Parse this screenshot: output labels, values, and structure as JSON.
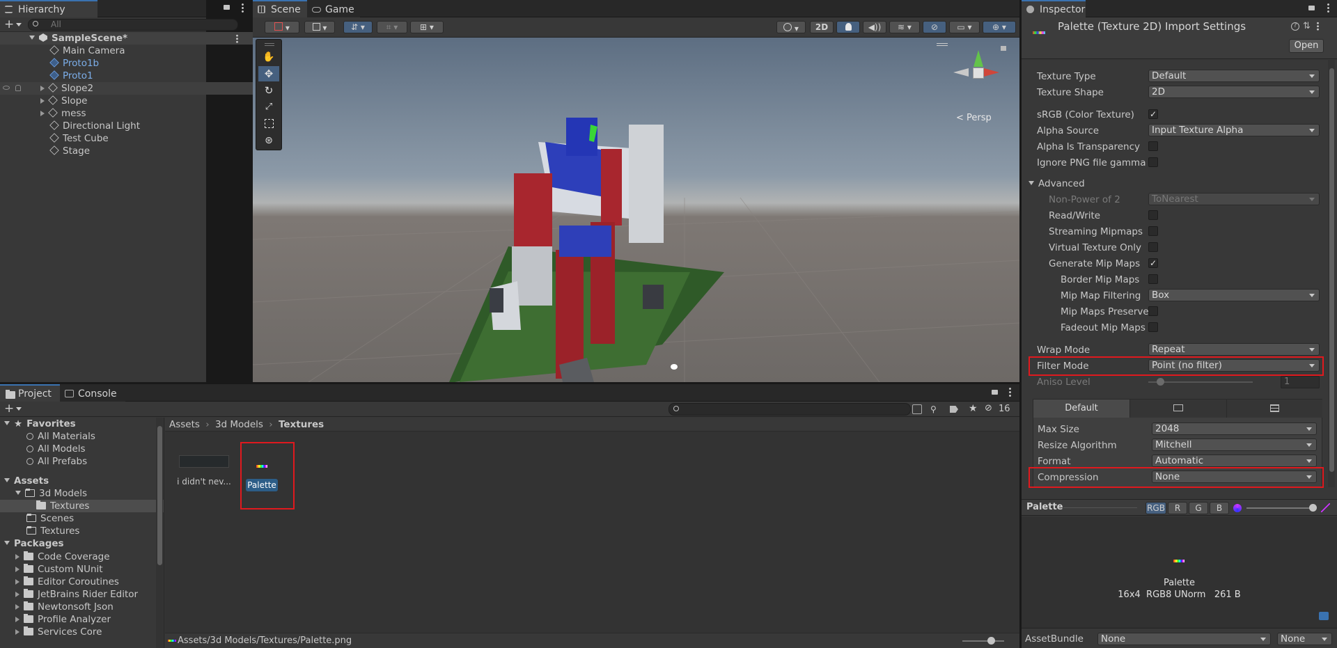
{
  "hierarchy": {
    "tab": "Hierarchy",
    "search_placeholder": "All",
    "scene_name": "SampleScene*",
    "items": [
      {
        "label": "Main Camera"
      },
      {
        "label": "Proto1b"
      },
      {
        "label": "Proto1"
      },
      {
        "label": "Slope2"
      },
      {
        "label": "Slope"
      },
      {
        "label": "mess"
      },
      {
        "label": "Directional Light"
      },
      {
        "label": "Test Cube"
      },
      {
        "label": "Stage"
      }
    ]
  },
  "scene": {
    "tabs": [
      "Scene",
      "Game"
    ],
    "btn_2d": "2D",
    "persp_label": "< Persp"
  },
  "inspector": {
    "tab": "Inspector",
    "title": "Palette (Texture 2D) Import Settings",
    "open_button": "Open",
    "fields": {
      "texture_type": {
        "label": "Texture Type",
        "value": "Default"
      },
      "texture_shape": {
        "label": "Texture Shape",
        "value": "2D"
      },
      "srgb": {
        "label": "sRGB (Color Texture)",
        "checked": "✓"
      },
      "alpha_source": {
        "label": "Alpha Source",
        "value": "Input Texture Alpha"
      },
      "alpha_transparency": {
        "label": "Alpha Is Transparency"
      },
      "ignore_png_gamma": {
        "label": "Ignore PNG file gamma"
      },
      "advanced": {
        "label": "Advanced"
      },
      "non_power_of_2": {
        "label": "Non-Power of 2",
        "value": "ToNearest"
      },
      "read_write": {
        "label": "Read/Write"
      },
      "streaming_mipmaps": {
        "label": "Streaming Mipmaps"
      },
      "virtual_texture_only": {
        "label": "Virtual Texture Only"
      },
      "generate_mip_maps": {
        "label": "Generate Mip Maps",
        "checked": "✓"
      },
      "border_mip_maps": {
        "label": "Border Mip Maps"
      },
      "mip_map_filtering": {
        "label": "Mip Map Filtering",
        "value": "Box"
      },
      "mip_maps_preserve": {
        "label": "Mip Maps Preserve"
      },
      "fadeout_mip_maps": {
        "label": "Fadeout Mip Maps"
      },
      "wrap_mode": {
        "label": "Wrap Mode",
        "value": "Repeat"
      },
      "filter_mode": {
        "label": "Filter Mode",
        "value": "Point (no filter)"
      },
      "aniso_level": {
        "label": "Aniso Level",
        "value": "1"
      }
    },
    "platform_tab_default": "Default",
    "platform": {
      "max_size": {
        "label": "Max Size",
        "value": "2048"
      },
      "resize_algorithm": {
        "label": "Resize Algorithm",
        "value": "Mitchell"
      },
      "format": {
        "label": "Format",
        "value": "Automatic"
      },
      "compression": {
        "label": "Compression",
        "value": "None"
      }
    },
    "preview": {
      "title": "Palette",
      "channels": [
        "RGB",
        "R",
        "G",
        "B"
      ],
      "name": "Palette",
      "info": "16x4  RGB8 UNorm   261 B"
    },
    "asset_bundle": {
      "label": "AssetBundle",
      "value1": "None",
      "value2": "None"
    }
  },
  "project": {
    "tabs": [
      "Project",
      "Console"
    ],
    "hidden_count": "16",
    "favorites": {
      "label": "Favorites",
      "items": [
        "All Materials",
        "All Models",
        "All Prefabs"
      ]
    },
    "assets": {
      "label": "Assets",
      "items": [
        "3d Models",
        "Textures",
        "Scenes",
        "Textures"
      ]
    },
    "packages": {
      "label": "Packages",
      "items": [
        "Code Coverage",
        "Custom NUnit",
        "Editor Coroutines",
        "JetBrains Rider Editor",
        "Newtonsoft Json",
        "Profile Analyzer",
        "Services Core"
      ]
    },
    "breadcrumb": [
      "Assets",
      "3d Models",
      "Textures"
    ],
    "files": [
      {
        "label": "i didn't nev..."
      },
      {
        "label": "Palette"
      }
    ],
    "status_path": "Assets/3d Models/Textures/Palette.png"
  }
}
